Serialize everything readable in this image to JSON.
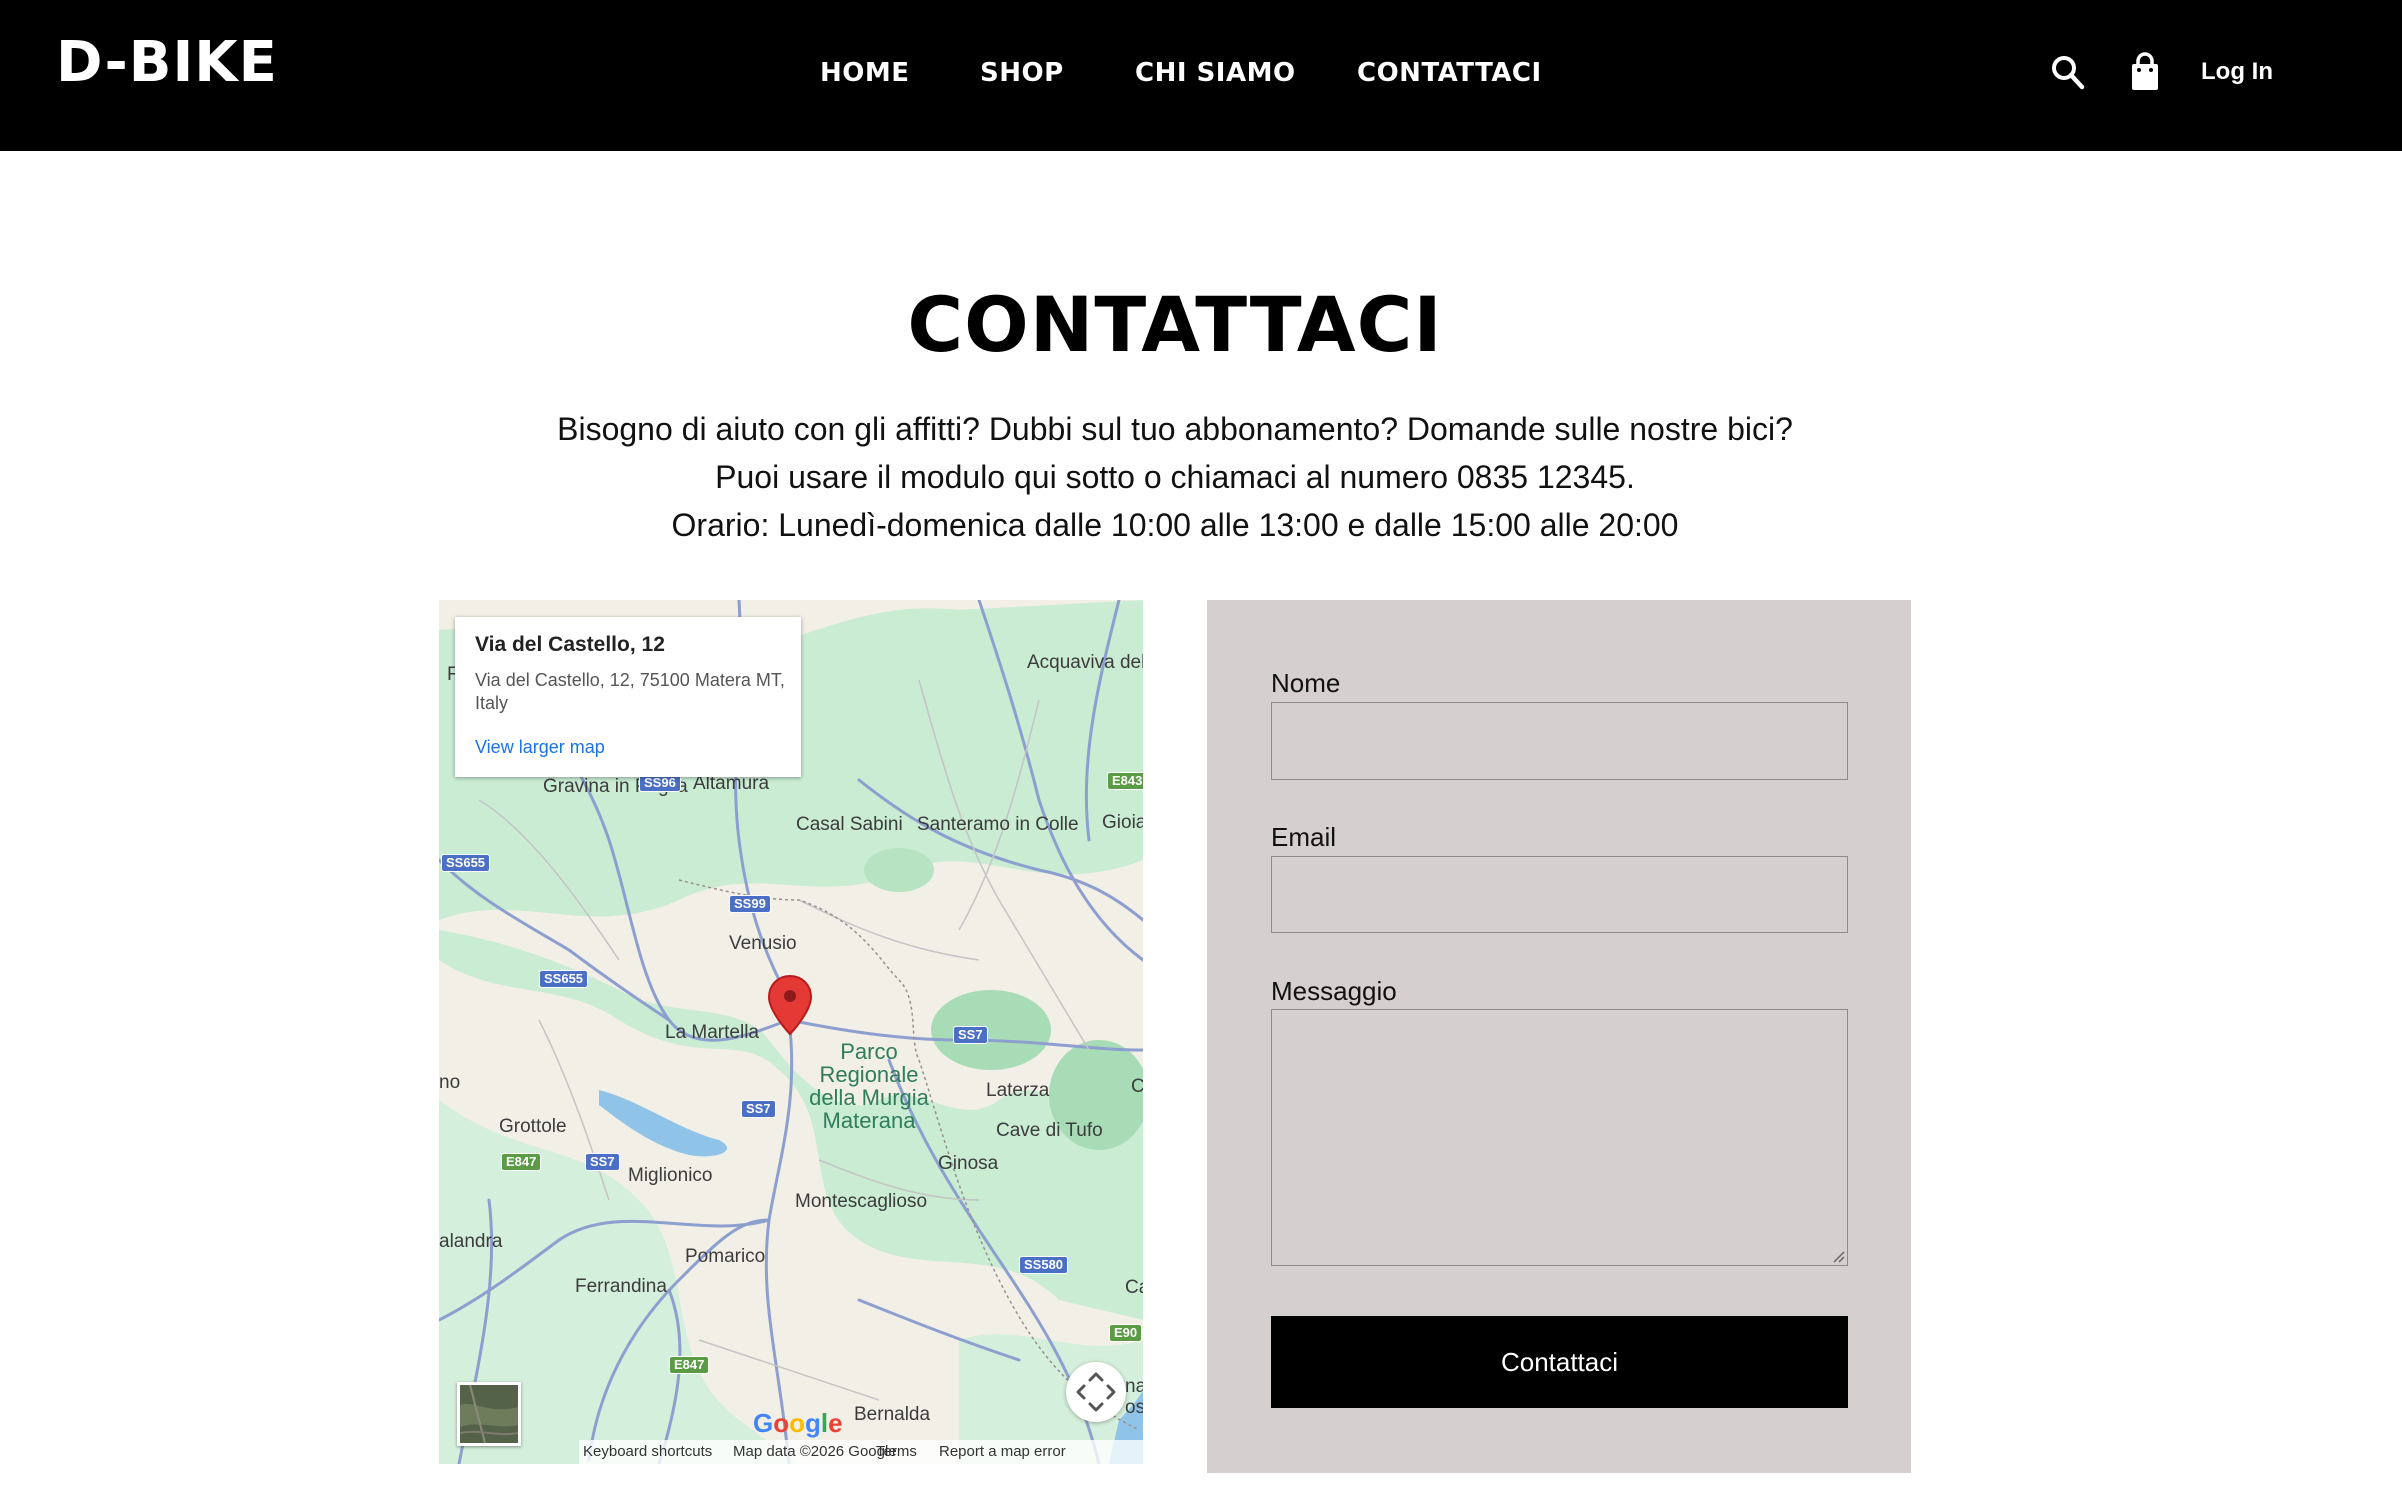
{
  "header": {
    "logo": "D-BIKE",
    "nav": [
      "HOME",
      "SHOP",
      "CHI SIAMO",
      "CONTATTACI"
    ],
    "login_label": "Log In",
    "icons": [
      "search-icon",
      "shopping-bag-icon"
    ]
  },
  "intro": {
    "title": "CONTATTACI",
    "lines": [
      "Bisogno di aiuto con gli affitti? Dubbi sul tuo abbonamento? Domande sulle nostre bici?",
      "Puoi usare il modulo qui sotto o chiamaci al numero 0835 12345.",
      "Orario: Lunedì-domenica dalle 10:00 alle 13:00 e dalle 15:00 alle 20:00"
    ]
  },
  "map": {
    "info_title": "Via del Castello, 12",
    "info_address": "Via del Castello, 12, 75100 Matera MT, Italy",
    "info_link": "View larger map",
    "places": [
      "Acquaviva delle Fonti",
      "Gravina in Puglia",
      "Altamura",
      "Casal Sabini",
      "Santeramo in Colle",
      "Gioia",
      "Venusio",
      "La Martella",
      "Laterza",
      "Grottole",
      "Miglionico",
      "Cave di Tufo",
      "Ginosa",
      "Montescaglioso",
      "Pomarico",
      "Ferrandina",
      "Bernalda",
      "alandra",
      "no",
      "Ca",
      "C",
      "na os",
      "F"
    ],
    "park": "Parco Regionale della Murgia Materana",
    "shields": {
      "ss96": "SS96",
      "e843": "E843",
      "ss655a": "SS655",
      "ss99": "SS99",
      "ss655b": "SS655",
      "ss7a": "SS7",
      "ss7b": "SS7",
      "e847a": "E847",
      "ss7c": "SS7",
      "ss580": "SS580",
      "e90": "E90",
      "e847b": "E847"
    },
    "footer": [
      "Keyboard shortcuts",
      "Map data ©2026 Google",
      "Terms",
      "Report a map error"
    ]
  },
  "form": {
    "name_label": "Nome",
    "email_label": "Email",
    "message_label": "Messaggio",
    "submit_label": "Contattaci"
  },
  "colors": {
    "header_bg": "#000000",
    "form_bg": "#d6cfcf",
    "button_bg": "#000000",
    "link": "#1a73e8",
    "marker": "#e53935"
  }
}
